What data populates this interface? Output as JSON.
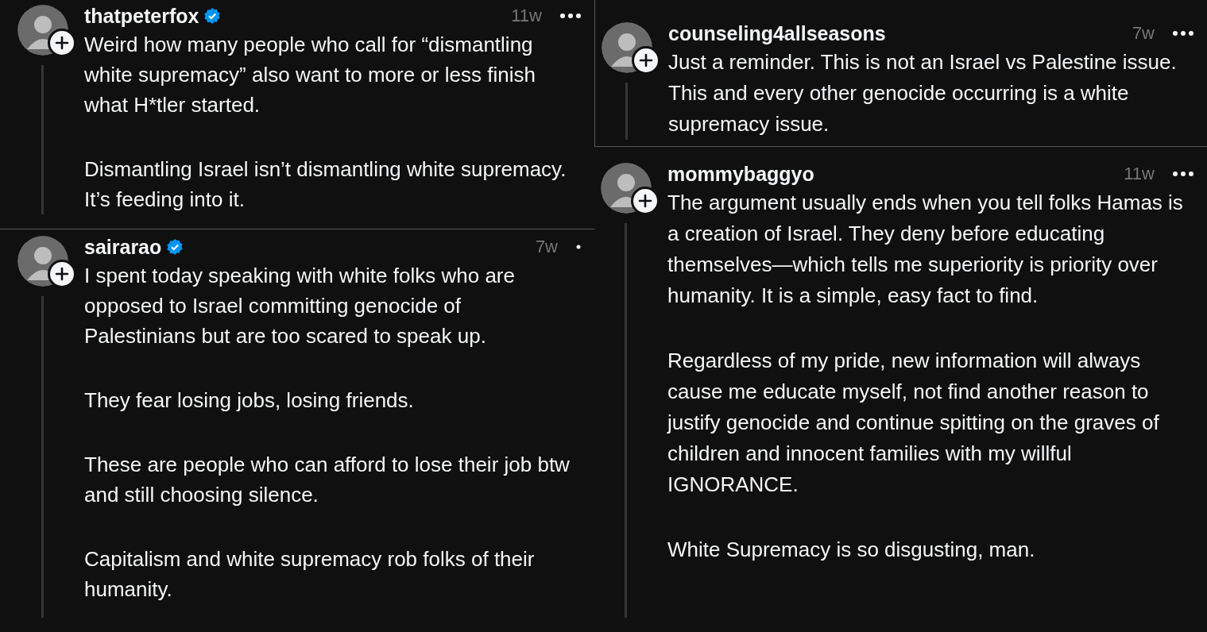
{
  "columns": [
    {
      "posts": [
        {
          "username": "thatpeterfox",
          "verified": true,
          "time": "11w",
          "kind": "full",
          "paragraphs": [
            "Weird how many people who call for “dismantling white supremacy” also want to more or less finish what H*tler started.",
            "Dismantling Israel isn’t dismantling white supremacy. It’s feeding into it."
          ]
        },
        {
          "username": "sairarao",
          "verified": true,
          "time": "7w",
          "kind": "cropped",
          "paragraphs": [
            "I spent today speaking with white folks who are opposed to Israel committing genocide of Palestinians but are too scared to speak up.",
            "They fear losing jobs, losing friends.",
            "These are people who can afford to lose their job btw and still choosing silence.",
            "Capitalism and white supremacy rob folks of their humanity."
          ]
        }
      ]
    },
    {
      "posts": [
        {
          "username": "counseling4allseasons",
          "verified": false,
          "time": "7w",
          "kind": "full",
          "paragraphs": [
            "Just a reminder. This is not an Israel vs Palestine issue. This and every other genocide occurring is a white supremacy issue."
          ]
        },
        {
          "username": "mommybaggyo",
          "verified": false,
          "time": "11w",
          "kind": "full",
          "paragraphs": [
            "The argument usually ends when you tell folks Hamas is a creation of Israel. They deny before educating themselves—which tells me superiority is priority over humanity. It is a simple, easy fact to find.",
            "Regardless of my pride, new information will always cause me educate myself, not find another reason to justify genocide and continue spitting on the graves of children and innocent families with my willful IGNORANCE.",
            "White Supremacy is so disgusting, man."
          ]
        }
      ]
    }
  ]
}
